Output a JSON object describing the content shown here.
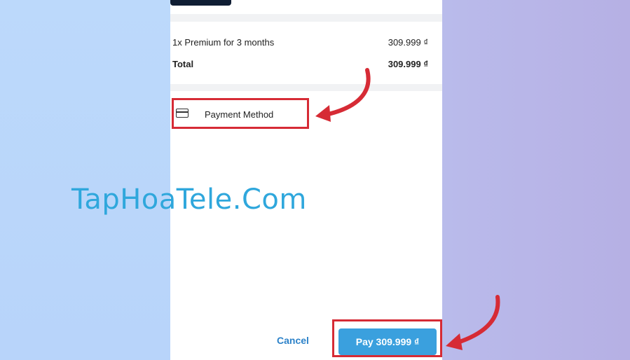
{
  "order": {
    "item_label": "1x Premium for 3 months",
    "item_price": "309.999 ₫",
    "total_label": "Total",
    "total_price": "309.999 ₫"
  },
  "payment_method": {
    "label": "Payment Method",
    "icon": "credit-card-icon"
  },
  "actions": {
    "cancel_label": "Cancel",
    "pay_label": "Pay 309.999 ₫"
  },
  "watermark": "TapHoaTele.Com",
  "colors": {
    "highlight": "#d62b35",
    "pay_button": "#3aa0de",
    "cancel_text": "#2c82c9",
    "watermark": "#2fa7dc"
  }
}
